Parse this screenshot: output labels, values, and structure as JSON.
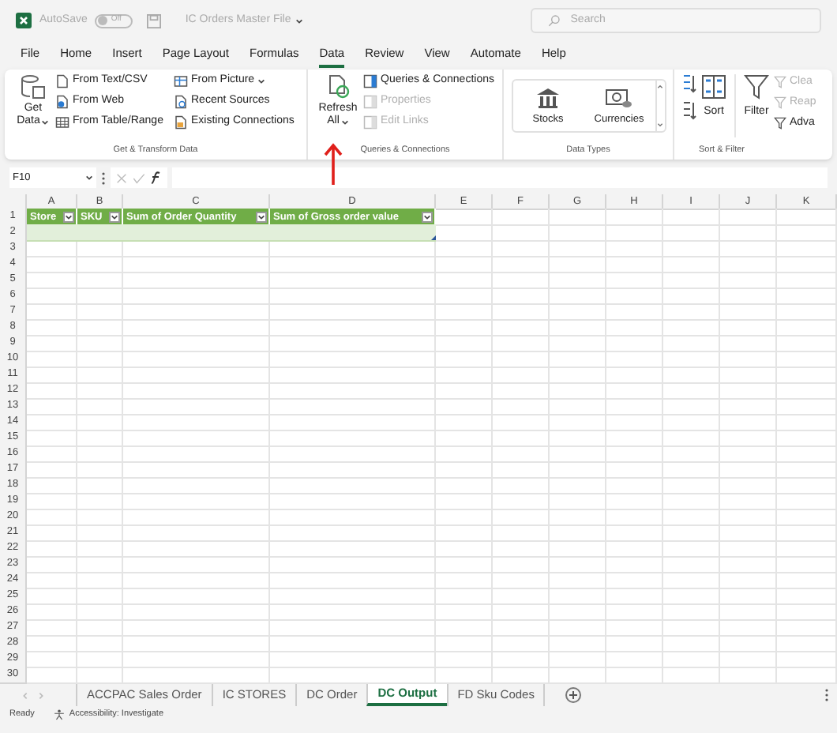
{
  "title_bar": {
    "autosave_label": "AutoSave",
    "autosave_toggle": {
      "on": false,
      "label": "Off"
    },
    "file_name": "IC Orders Master File",
    "search": {
      "placeholder": "Search"
    }
  },
  "menu_tabs": [
    {
      "label": "File",
      "selected": false
    },
    {
      "label": "Home",
      "selected": false
    },
    {
      "label": "Insert",
      "selected": false
    },
    {
      "label": "Page Layout",
      "selected": false
    },
    {
      "label": "Formulas",
      "selected": false
    },
    {
      "label": "Data",
      "selected": true
    },
    {
      "label": "Review",
      "selected": false
    },
    {
      "label": "View",
      "selected": false
    },
    {
      "label": "Automate",
      "selected": false
    },
    {
      "label": "Help",
      "selected": false
    }
  ],
  "ribbon": {
    "get_transform": {
      "title": "Get & Transform Data",
      "large_button": {
        "line_1": "Get",
        "line_2": "Data"
      },
      "column_1": [
        {
          "label": "From Text/CSV",
          "kind": "text"
        },
        {
          "label": "From Web",
          "kind": "web"
        },
        {
          "label": "From Table/Range",
          "kind": "table"
        }
      ],
      "column_2": [
        {
          "label": "From Picture",
          "kind": "picture",
          "dropdown": true
        },
        {
          "label": "Recent Sources",
          "kind": "recent",
          "dropdown": false
        },
        {
          "label": "Existing Connections",
          "kind": "existing",
          "dropdown": false
        }
      ]
    },
    "queries": {
      "title": "Queries & Connections",
      "large_button": {
        "line_1": "Refresh",
        "line_2": "All"
      },
      "items": [
        {
          "label": "Queries & Connections",
          "disabled": false
        },
        {
          "label": "Properties",
          "disabled": true
        },
        {
          "label": "Edit Links",
          "disabled": true
        }
      ]
    },
    "data_types": {
      "title": "Data Types",
      "items": [
        {
          "label": "Stocks",
          "kind": "stocks"
        },
        {
          "label": "Currencies",
          "kind": "currencies"
        }
      ]
    },
    "sort_filter": {
      "title": "Sort & Filter",
      "sort": "Sort",
      "filter": "Filter",
      "items": [
        {
          "label": "Clea",
          "disabled": true
        },
        {
          "label": "Reap",
          "disabled": true
        },
        {
          "label": "Adva",
          "disabled": false
        }
      ]
    }
  },
  "formula_bar": {
    "name_box": "F10"
  },
  "sheet": {
    "columns": [
      "A",
      "B",
      "C",
      "D",
      "E",
      "F",
      "G",
      "H",
      "I",
      "J",
      "K"
    ],
    "pivot_headers": [
      "Store",
      "SKU",
      "Sum of Order Quantity",
      "Sum of Gross order value"
    ],
    "rows": [
      "1",
      "2",
      "3",
      "4",
      "5",
      "6",
      "7",
      "8",
      "9",
      "10",
      "11",
      "12",
      "13",
      "14",
      "15",
      "16",
      "17",
      "18",
      "19",
      "20",
      "21",
      "22",
      "23",
      "24",
      "25",
      "26",
      "27",
      "28",
      "29",
      "30"
    ]
  },
  "sheet_tabs": [
    {
      "label": "ACCPAC Sales Order",
      "selected": false
    },
    {
      "label": "IC STORES",
      "selected": false
    },
    {
      "label": "DC Order",
      "selected": false
    },
    {
      "label": "DC Output",
      "selected": true
    },
    {
      "label": "FD Sku Codes",
      "selected": false
    }
  ],
  "status_bar": {
    "mode": "Ready",
    "accessibility": "Accessibility: Investigate"
  }
}
